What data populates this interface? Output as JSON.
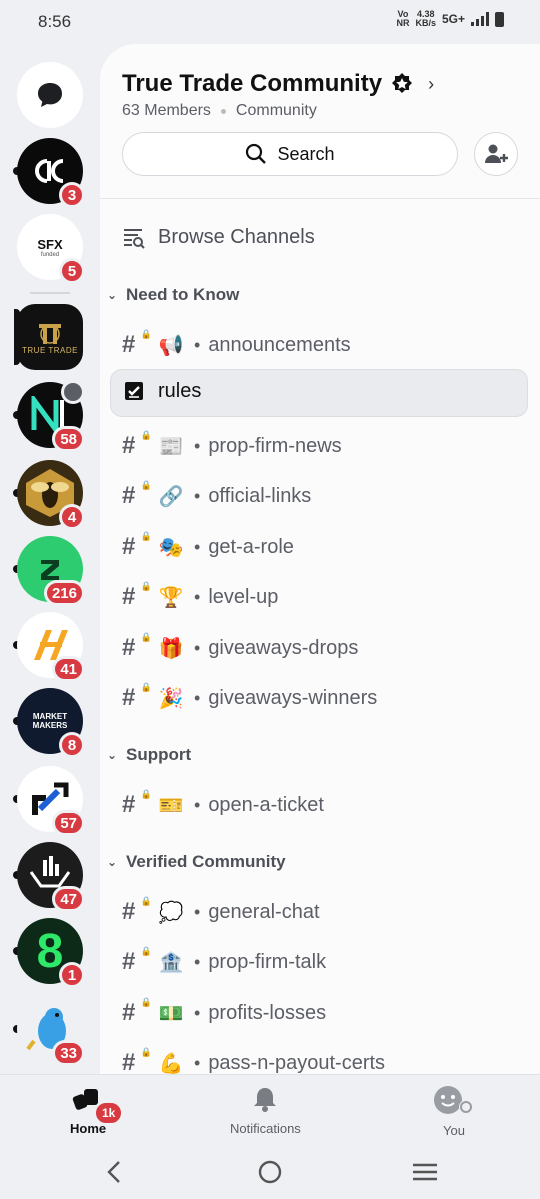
{
  "status": {
    "time": "8:56",
    "net_top": "Vo",
    "net_bottom": "NR",
    "speed_top": "4.38",
    "speed_bottom": "KB/s",
    "network": "5G+"
  },
  "rail": {
    "servers": [
      {
        "name": "dm",
        "badge": ""
      },
      {
        "name": "ac",
        "badge": "3"
      },
      {
        "name": "sfx-funded",
        "badge": "5",
        "logo_text": "SFX",
        "logo_sub": "funded"
      },
      {
        "name": "true-trade",
        "badge": "",
        "logo_text": "TRUE TRADE"
      },
      {
        "name": "n-server",
        "badge": "58"
      },
      {
        "name": "bee-server",
        "badge": "4"
      },
      {
        "name": "green-server",
        "badge": "216"
      },
      {
        "name": "h-server",
        "badge": "41"
      },
      {
        "name": "market-makers",
        "badge": "8",
        "logo_text": "MARKET MAKERS"
      },
      {
        "name": "arrow-server",
        "badge": "57"
      },
      {
        "name": "hands-server",
        "badge": "47"
      },
      {
        "name": "eight-server",
        "badge": "1",
        "logo_text": "8"
      },
      {
        "name": "dragon-server",
        "badge": "33"
      }
    ]
  },
  "server": {
    "name": "True Trade Community",
    "members": "63 Members",
    "type": "Community",
    "search_label": "Search"
  },
  "browse_label": "Browse Channels",
  "categories": [
    {
      "name": "Need to Know",
      "channels": [
        {
          "emoji": "📢",
          "name": "announcements"
        },
        {
          "emoji": "",
          "name": "rules"
        },
        {
          "emoji": "📰",
          "name": "prop-firm-news"
        },
        {
          "emoji": "🔗",
          "name": "official-links"
        },
        {
          "emoji": "🎭",
          "name": "get-a-role"
        },
        {
          "emoji": "🏆",
          "name": "level-up"
        },
        {
          "emoji": "🎁",
          "name": "giveaways-drops"
        },
        {
          "emoji": "🎉",
          "name": "giveaways-winners"
        }
      ]
    },
    {
      "name": "Support",
      "channels": [
        {
          "emoji": "🎫",
          "name": "open-a-ticket"
        }
      ]
    },
    {
      "name": "Verified Community",
      "channels": [
        {
          "emoji": "💭",
          "name": "general-chat"
        },
        {
          "emoji": "🏦",
          "name": "prop-firm-talk"
        },
        {
          "emoji": "💵",
          "name": "profits-losses"
        },
        {
          "emoji": "💪",
          "name": "pass-n-payout-certs"
        }
      ]
    }
  ],
  "bullet": "•",
  "nav": {
    "home": "Home",
    "home_badge": "1k",
    "notifications": "Notifications",
    "you": "You"
  },
  "colors": {
    "badge": "#d83a42",
    "accent_green": "#2ecc71"
  }
}
